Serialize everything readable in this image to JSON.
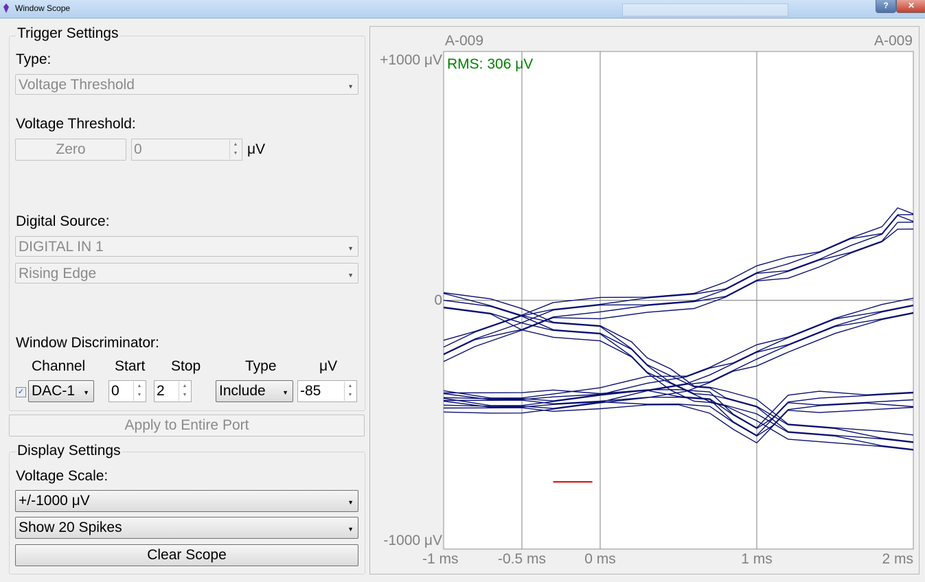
{
  "window": {
    "title": "Window Scope",
    "help_label": "?",
    "close_label": "✕"
  },
  "trigger": {
    "group_title": "Trigger Settings",
    "type_label": "Type:",
    "type_value": "Voltage Threshold",
    "voltage_threshold_label": "Voltage Threshold:",
    "zero_button": "Zero",
    "threshold_value": "0",
    "threshold_unit": "μV",
    "digital_source_label": "Digital Source:",
    "digital_source_value": "DIGITAL IN 1",
    "edge_value": "Rising Edge"
  },
  "window_discriminator": {
    "label": "Window Discriminator:",
    "headers": {
      "channel": "Channel",
      "start": "Start",
      "stop": "Stop",
      "type": "Type",
      "unit": "μV"
    },
    "enabled": true,
    "channel_value": "DAC-1",
    "start_value": "0",
    "stop_value": "2",
    "type_value": "Include",
    "uv_value": "-85"
  },
  "apply_button": "Apply to Entire Port",
  "display": {
    "group_title": "Display Settings",
    "voltage_scale_label": "Voltage Scale:",
    "voltage_scale_value": "+/-1000 μV",
    "spikes_value": "Show 20 Spikes",
    "clear_button": "Clear Scope"
  },
  "scope": {
    "channel_left": "A-009",
    "channel_right": "A-009",
    "rms_text": "RMS: 306 μV",
    "y_top_label": "+1000 μV",
    "y_zero_label": "0",
    "y_bottom_label": "-1000 μV",
    "x_labels": [
      "-1 ms",
      "-0.5 ms",
      "0 ms",
      "1 ms",
      "2 ms"
    ],
    "colors": {
      "trace": "#0a1070",
      "window": "#e00000",
      "rms": "#008000",
      "axis_text": "#808080"
    }
  },
  "chart_data": {
    "type": "line",
    "xlim": [
      -1,
      2
    ],
    "ylim": [
      -1000,
      1000
    ],
    "x_ticks": [
      -1,
      -0.5,
      0,
      1,
      2
    ],
    "y_ticks": [
      -1000,
      0,
      1000
    ],
    "grid": true,
    "window_marker": {
      "x": [
        -0.3,
        -0.05
      ],
      "y": -730
    },
    "series": [
      {
        "x": [
          -1,
          -0.8,
          -0.5,
          -0.3,
          0,
          0.3,
          0.6,
          0.8,
          1.0,
          1.2,
          1.4,
          1.6,
          1.8,
          1.9,
          2.0
        ],
        "values": [
          -205,
          -150,
          -90,
          -45,
          -30,
          -10,
          0,
          40,
          100,
          130,
          170,
          220,
          260,
          330,
          325
        ]
      },
      {
        "x": [
          -1,
          -0.7,
          -0.5,
          -0.3,
          0,
          0.2,
          0.3,
          0.45,
          0.6,
          0.7,
          0.8,
          1.0,
          1.2,
          1.5,
          1.8,
          2.0
        ],
        "values": [
          0,
          -30,
          -75,
          -110,
          -130,
          -200,
          -270,
          -320,
          -370,
          -380,
          -400,
          -440,
          -520,
          -540,
          -560,
          -580
        ]
      },
      {
        "x": [
          -1,
          -0.7,
          -0.5,
          -0.3,
          0,
          0.3,
          0.55,
          0.7,
          0.85,
          1.0,
          1.2,
          1.5,
          1.8,
          2.0
        ],
        "values": [
          -405,
          -415,
          -420,
          -410,
          -390,
          -350,
          -330,
          -300,
          -260,
          -220,
          -170,
          -100,
          -50,
          -30
        ]
      },
      {
        "x": [
          -1,
          -0.7,
          -0.5,
          -0.3,
          0,
          0.3,
          0.5,
          0.7,
          0.85,
          1.0,
          1.1,
          1.2,
          1.4,
          1.7,
          2.0
        ],
        "values": [
          -400,
          -405,
          -410,
          -405,
          -400,
          -390,
          -395,
          -410,
          -480,
          -540,
          -480,
          -420,
          -410,
          -405,
          -400
        ]
      }
    ]
  }
}
